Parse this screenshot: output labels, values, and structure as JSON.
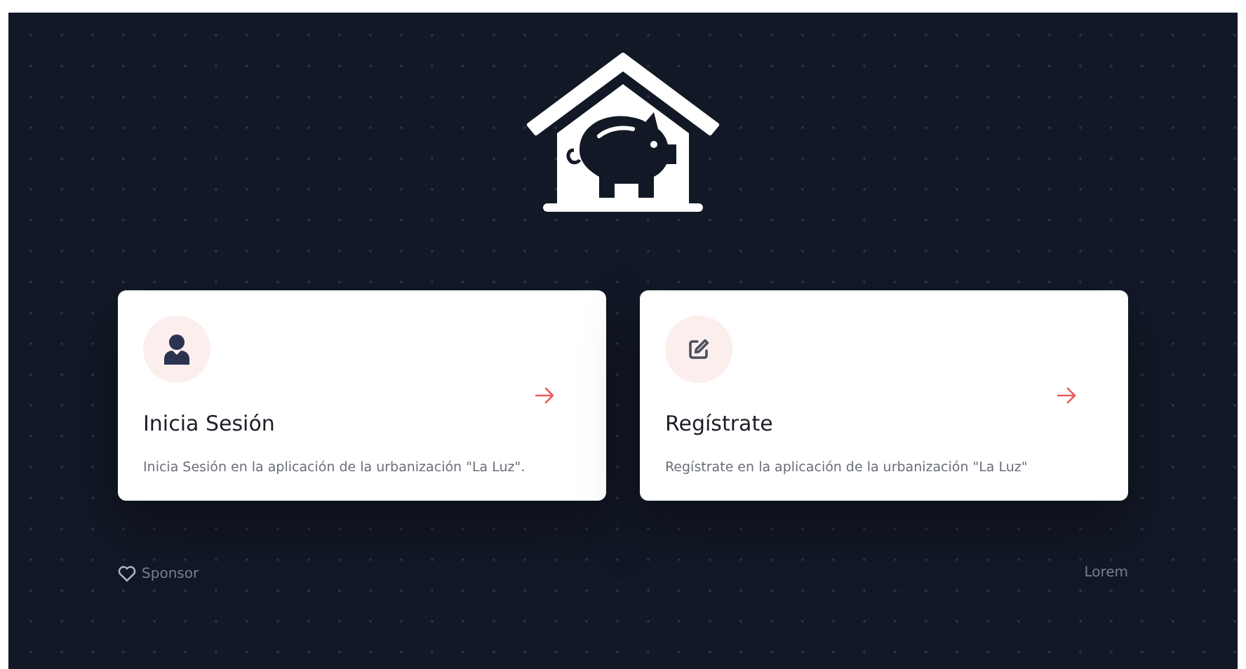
{
  "cards": [
    {
      "kind": "login",
      "title": "Inicia Sesión",
      "description": "Inicia Sesión en la aplicación de la urbanización \"La Luz\"."
    },
    {
      "kind": "register",
      "title": "Regístrate",
      "description": "Regístrate en la aplicación de la urbanización \"La Luz\""
    }
  ],
  "footer": {
    "sponsor": "Sponsor",
    "right": "Lorem"
  }
}
